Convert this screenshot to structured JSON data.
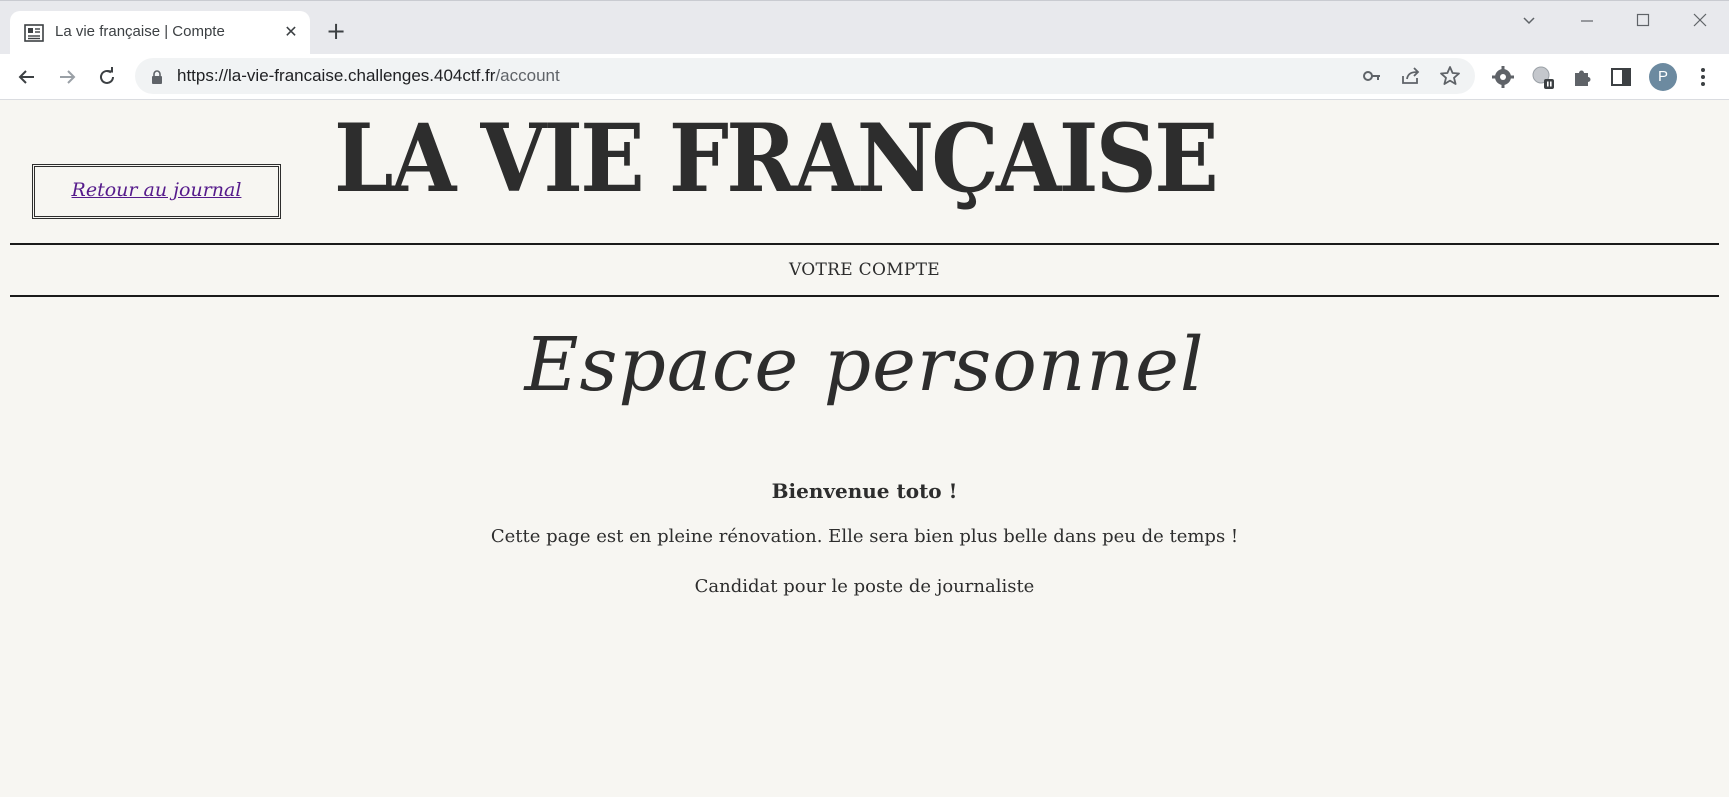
{
  "browser": {
    "tab_title": "La vie française | Compte",
    "tab_close": "✕",
    "new_tab": "+",
    "url_host": "https://la-vie-francaise.challenges.404ctf.fr",
    "url_path": "/account",
    "profile_initial": "P"
  },
  "page": {
    "back_link": "Retour au journal",
    "masthead": "LA VIE FRANÇAISE",
    "section_label": "VOTRE COMPTE",
    "heading": "Espace personnel",
    "welcome": "Bienvenue toto !",
    "notice": "Cette page est en pleine rénovation. Elle sera bien plus belle dans peu de temps !",
    "role": "Candidat pour le poste de journaliste"
  },
  "colors": {
    "page_background": "#f7f6f2",
    "text": "#2d2d2d",
    "link": "#551a8b"
  }
}
